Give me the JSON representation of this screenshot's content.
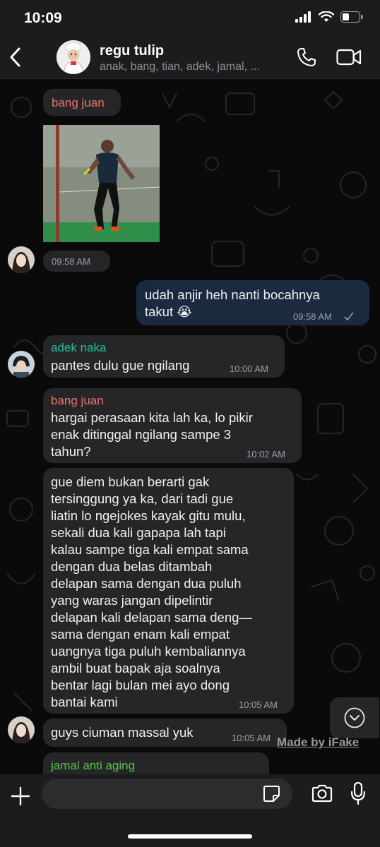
{
  "status_bar": {
    "time": "10:09"
  },
  "header": {
    "title": "regu tulip",
    "members": "anak, bang, tian, adek, jamal, ..."
  },
  "colors": {
    "bang_juan": "#e8736f",
    "adek_naka": "#1fbf9c",
    "jamal": "#58c64a",
    "outgoing_bubble": "#1c2a40",
    "incoming_bubble": "#262628"
  },
  "messages": [
    {
      "type": "incoming-photo",
      "sender": "bang juan",
      "time": "09:58 AM"
    },
    {
      "type": "outgoing",
      "lines": [
        "udah anjir heh nanti bocahnya",
        "takut 😭"
      ],
      "time": "09:58 AM"
    },
    {
      "type": "incoming",
      "sender": "adek naka",
      "lines": [
        "pantes dulu gue ngilang"
      ],
      "time": "10:00 AM"
    },
    {
      "type": "incoming",
      "sender": "bang juan",
      "lines": [
        "hargai perasaan kita lah ka, lo pikir",
        "enak ditinggal ngilang sampe 3",
        "tahun?"
      ],
      "time": "10:02 AM"
    },
    {
      "type": "incoming",
      "sender": "",
      "lines": [
        "gue diem bukan berarti gak",
        "tersinggung ya ka, dari tadi gue",
        "liatin lo ngejokes kayak gitu mulu,",
        "sekali dua kali gapapa lah tapi",
        "kalau sampe tiga kali empat sama",
        "dengan dua belas ditambah",
        "delapan sama dengan dua puluh",
        "yang waras jangan dipelintir",
        "delapan kali delapan sama deng—",
        "sama dengan enam kali empat",
        "uangnya tiga puluh kembaliannya",
        "ambil buat bapak aja soalnya",
        "bentar lagi bulan mei ayo dong",
        "bantai kami"
      ],
      "time": "10:05 AM"
    },
    {
      "type": "incoming",
      "sender": "",
      "lines": [
        "guys ciuman massal yuk"
      ],
      "time": "10:05 AM"
    },
    {
      "type": "incoming-partial",
      "sender": "jamal anti aging"
    }
  ],
  "watermark": "Made by iFake",
  "composer": {
    "placeholder": ""
  },
  "icons": [
    "back-chevron-icon",
    "phone-icon",
    "video-camera-icon",
    "plus-icon",
    "sticker-icon",
    "camera-icon",
    "microphone-icon",
    "chevron-down-icon",
    "double-check-icon"
  ]
}
